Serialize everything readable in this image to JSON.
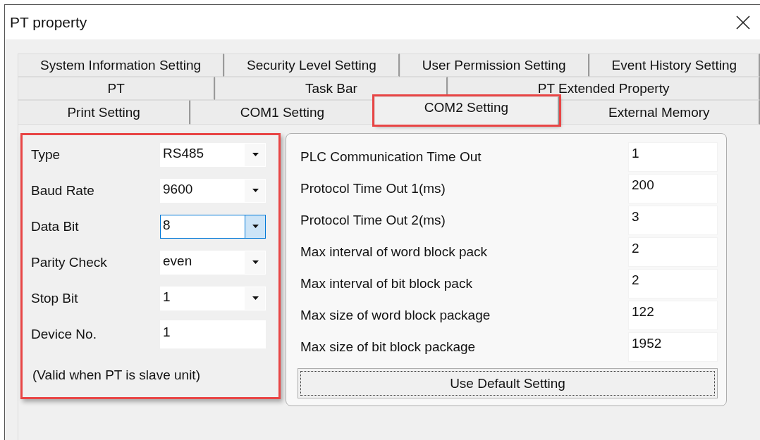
{
  "window": {
    "title": "PT property"
  },
  "tab_rows": [
    {
      "tabs": [
        {
          "label": "System Information Setting",
          "selected": false,
          "highlighted": false
        },
        {
          "label": "Security Level Setting",
          "selected": false,
          "highlighted": false
        },
        {
          "label": "User Permission Setting",
          "selected": false,
          "highlighted": false
        },
        {
          "label": "Event History Setting",
          "selected": false,
          "highlighted": false
        }
      ]
    },
    {
      "tabs": [
        {
          "label": "PT",
          "selected": false,
          "highlighted": false
        },
        {
          "label": "Task Bar",
          "selected": false,
          "highlighted": false
        },
        {
          "label": "PT Extended Property",
          "selected": false,
          "highlighted": false
        }
      ]
    },
    {
      "tabs": [
        {
          "label": "Print Setting",
          "selected": false,
          "highlighted": false
        },
        {
          "label": "COM1 Setting",
          "selected": false,
          "highlighted": false
        },
        {
          "label": "COM2 Setting",
          "selected": true,
          "highlighted": true
        },
        {
          "label": "External Memory",
          "selected": false,
          "highlighted": false
        }
      ]
    }
  ],
  "port_settings": {
    "highlighted": true,
    "fields": [
      {
        "label": "Type",
        "kind": "dropdown",
        "value": "RS485",
        "focused": false
      },
      {
        "label": "Baud Rate",
        "kind": "dropdown",
        "value": "9600",
        "focused": false
      },
      {
        "label": "Data Bit",
        "kind": "dropdown",
        "value": "8",
        "focused": true
      },
      {
        "label": "Parity Check",
        "kind": "dropdown",
        "value": "even",
        "focused": false
      },
      {
        "label": "Stop Bit",
        "kind": "dropdown",
        "value": "1",
        "focused": false
      },
      {
        "label": "Device No.",
        "kind": "input",
        "value": "1",
        "focused": false
      }
    ],
    "note": "(Valid when PT is slave unit)"
  },
  "protocol_settings": {
    "fields": [
      {
        "label": "PLC Communication Time Out",
        "value": "1"
      },
      {
        "label": "Protocol Time Out 1(ms)",
        "value": "200"
      },
      {
        "label": "Protocol Time Out 2(ms)",
        "value": "3"
      },
      {
        "label": "Max interval of word block pack",
        "value": "2"
      },
      {
        "label": "Max interval of bit block pack",
        "value": "2"
      },
      {
        "label": "Max size of word block package",
        "value": "122"
      },
      {
        "label": "Max size of bit block package",
        "value": "1952"
      }
    ],
    "button": "Use Default Setting"
  }
}
